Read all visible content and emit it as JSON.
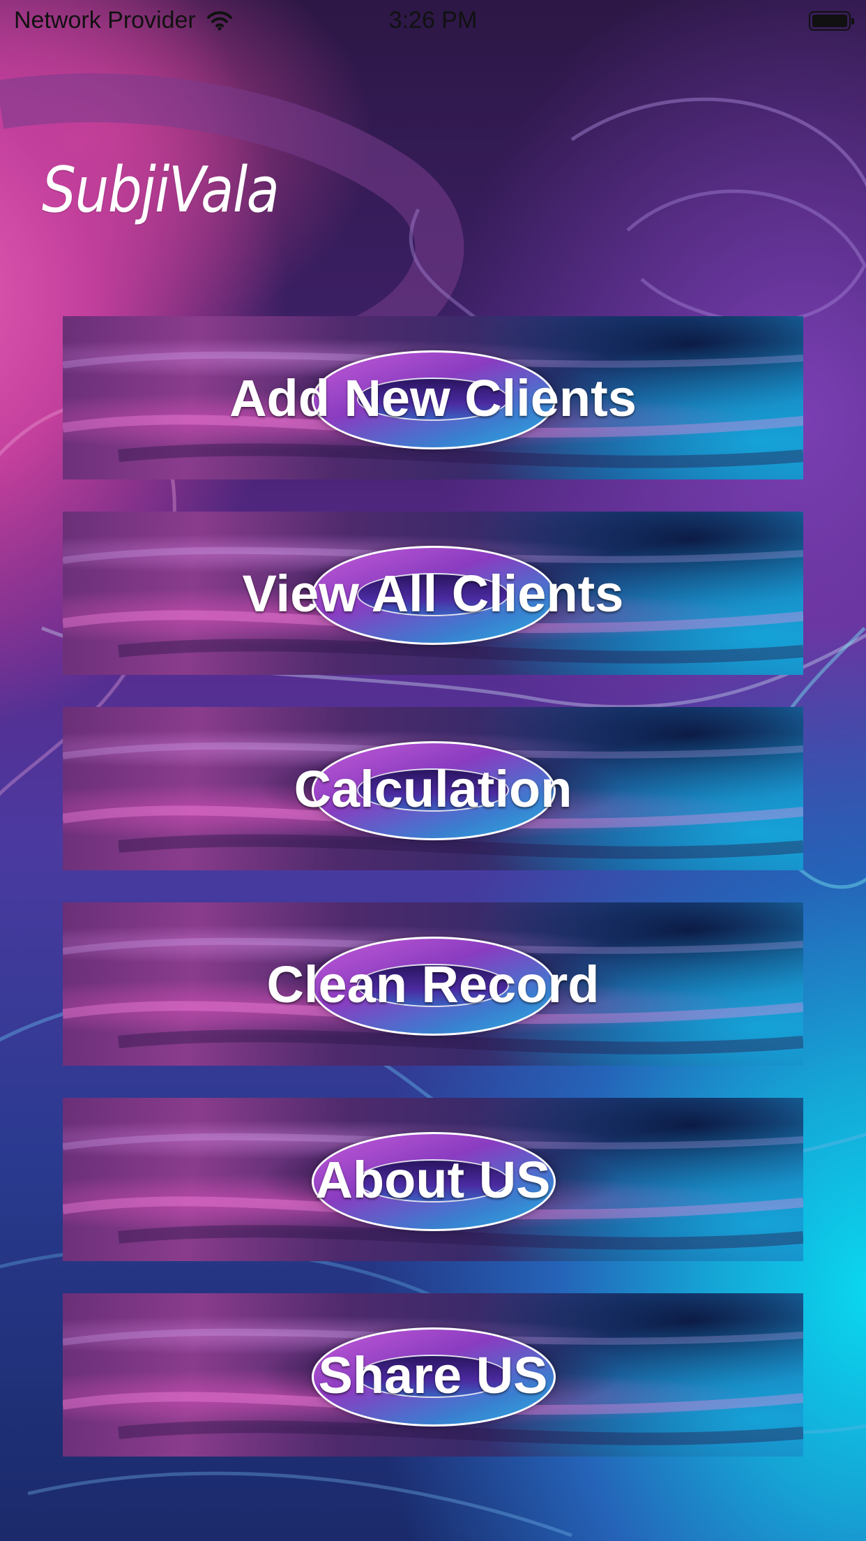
{
  "status_bar": {
    "carrier": "Network Provider",
    "time": "3:26 PM",
    "wifi_icon": "wifi-icon",
    "battery_icon": "battery-icon"
  },
  "app": {
    "title": "SubjiVala"
  },
  "menu": {
    "items": [
      {
        "label": "Add New Clients"
      },
      {
        "label": "View All Clients"
      },
      {
        "label": "Calculation"
      },
      {
        "label": "Clean Record"
      },
      {
        "label": "About US"
      },
      {
        "label": "Share US"
      }
    ]
  },
  "colors": {
    "background_pink": "#e05ab0",
    "background_purple": "#5a2a8c",
    "background_cyan": "#0ad8f0",
    "button_text": "#ffffff"
  }
}
